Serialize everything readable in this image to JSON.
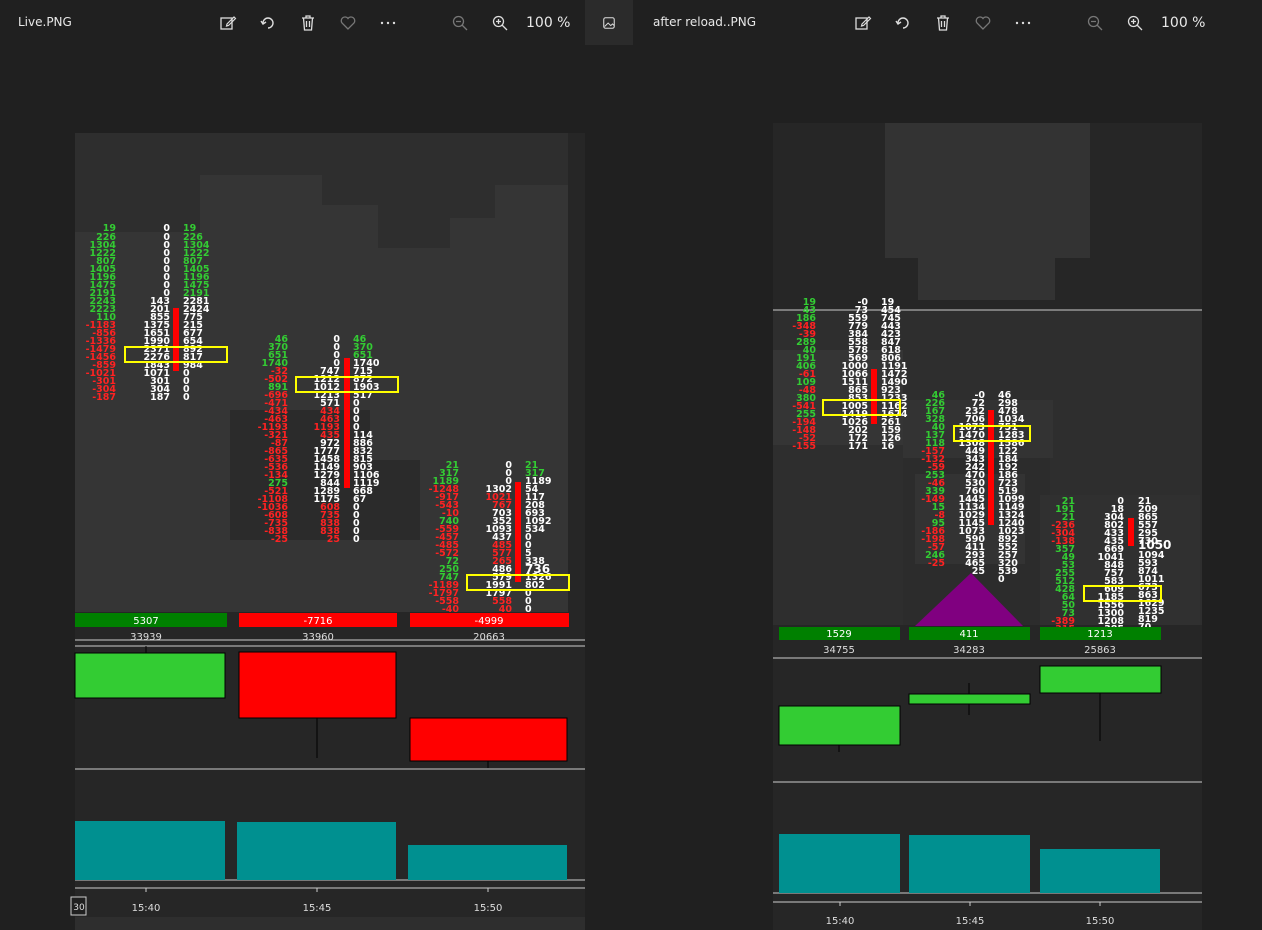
{
  "left": {
    "filename": "Live.PNG",
    "zoom": "100 %",
    "bars": [
      {
        "delta": "5307",
        "volume": "33939",
        "sign": "positive"
      },
      {
        "delta": "-7716",
        "volume": "33960",
        "sign": "negative"
      },
      {
        "delta": "-4999",
        "volume": "20663",
        "sign": "negative"
      }
    ],
    "time_labels": [
      "15:40",
      "15:45",
      "15:50"
    ],
    "corner_label": "30"
  },
  "right": {
    "filename": "after reload..PNG",
    "zoom": "100 %",
    "bars": [
      {
        "delta": "1529",
        "volume": "34755",
        "sign": "positive"
      },
      {
        "delta": "411",
        "volume": "34283",
        "sign": "positive"
      },
      {
        "delta": "1213",
        "volume": "25863",
        "sign": "positive"
      }
    ],
    "time_labels": [
      "15:40",
      "15:45",
      "15:50"
    ]
  },
  "toolbar_icons": [
    "edit-image-icon",
    "rotate-icon",
    "delete-icon",
    "favorite-icon",
    "more-icon",
    "zoom-out-icon",
    "zoom-in-icon"
  ],
  "colors": {
    "up": "#33cc33",
    "down": "#ff0000",
    "volume": "#009090",
    "poc_box": "#ffff00",
    "delta_pos": "#008000"
  }
}
